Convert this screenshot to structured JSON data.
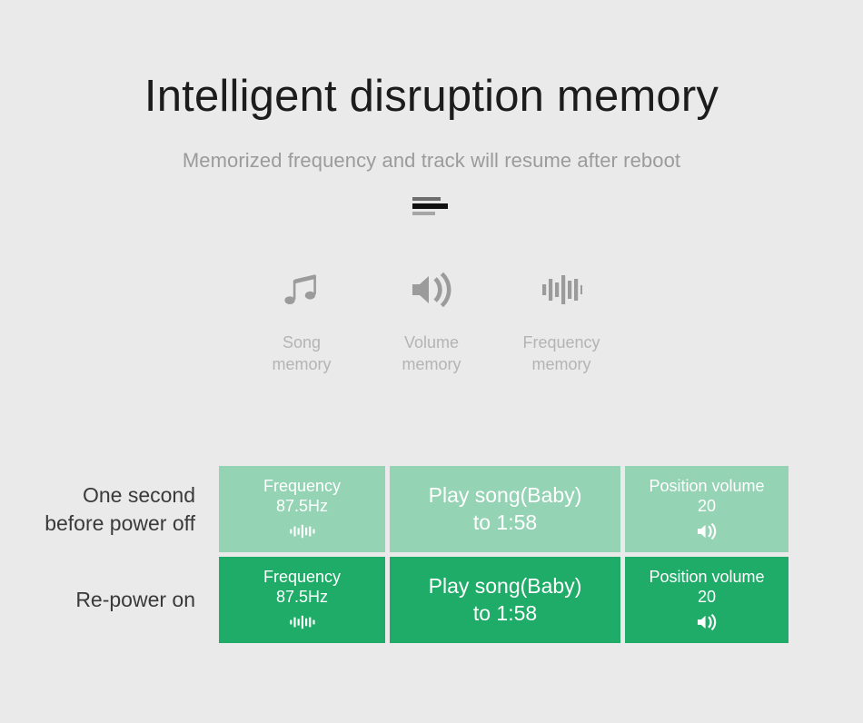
{
  "header": {
    "title": "Intelligent disruption memory",
    "subtitle": "Memorized frequency and track will resume after reboot"
  },
  "features": [
    {
      "icon": "music-note-icon",
      "label": "Song\nmemory"
    },
    {
      "icon": "speaker-volume-icon",
      "label": "Volume\nmemory"
    },
    {
      "icon": "equalizer-icon",
      "label": "Frequency\nmemory"
    }
  ],
  "matrix": {
    "rows": [
      {
        "state": "before-power-off",
        "label": "One second\nbefore power off",
        "cells": [
          {
            "name": "frequency",
            "text": "Frequency\n87.5Hz",
            "icon": "equalizer-icon"
          },
          {
            "name": "song",
            "text": "Play song(Baby)\nto 1:58",
            "icon": ""
          },
          {
            "name": "volume",
            "text": "Position volume\n20",
            "icon": "speaker-volume-icon"
          }
        ]
      },
      {
        "state": "re-power-on",
        "label": "Re-power on",
        "cells": [
          {
            "name": "frequency",
            "text": "Frequency\n87.5Hz",
            "icon": "equalizer-icon"
          },
          {
            "name": "song",
            "text": "Play song(Baby)\nto 1:58",
            "icon": ""
          },
          {
            "name": "volume",
            "text": "Position volume\n20",
            "icon": "speaker-volume-icon"
          }
        ]
      }
    ]
  },
  "colors": {
    "background": "#eaeaea",
    "green_light": "#94d3b4",
    "green_dark": "#1fab68",
    "title": "#1c1c1c",
    "subtitle": "#9b9b9b",
    "feature_label": "#b4b4b4",
    "row_label": "#3a3a3a",
    "cell_text": "#ffffff"
  }
}
